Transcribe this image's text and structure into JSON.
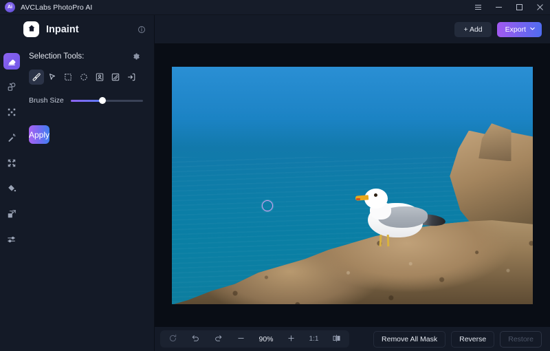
{
  "titlebar": {
    "logo_text": "Ai",
    "app_title": "AVCLabs PhotoPro AI",
    "menu_icon": "hamburger-menu-icon",
    "minimize_icon": "minimize-icon",
    "maximize_icon": "maximize-icon",
    "close_icon": "close-icon"
  },
  "panel": {
    "home_icon": "home-icon",
    "page_title": "Inpaint",
    "info_icon": "info-icon",
    "section_title": "Selection Tools:",
    "gear_icon": "gear-icon",
    "tools": [
      {
        "name": "brush-tool",
        "icon": "brush-icon",
        "active": true
      },
      {
        "name": "lasso-tool",
        "icon": "cursor-icon",
        "active": false
      },
      {
        "name": "rectangle-tool",
        "icon": "rectangle-icon",
        "active": false
      },
      {
        "name": "ellipse-tool",
        "icon": "ellipse-icon",
        "active": false
      },
      {
        "name": "portrait-tool",
        "icon": "portrait-icon",
        "active": false
      },
      {
        "name": "pattern-tool",
        "icon": "hatched-box-icon",
        "active": false
      },
      {
        "name": "import-tool",
        "icon": "arrow-into-box-icon",
        "active": false
      }
    ],
    "brush_size_label": "Brush Size",
    "brush_size_percent": 44,
    "apply_label": "Apply"
  },
  "rail": {
    "items": [
      {
        "name": "rail-item-inpaint",
        "icon": "eraser-icon",
        "active": true
      },
      {
        "name": "rail-item-replace",
        "icon": "object-swap-icon",
        "active": false
      },
      {
        "name": "rail-item-enhance",
        "icon": "sparkle-grid-icon",
        "active": false
      },
      {
        "name": "rail-item-magic",
        "icon": "magic-wand-icon",
        "active": false
      },
      {
        "name": "rail-item-upscale",
        "icon": "expand-corners-icon",
        "active": false
      },
      {
        "name": "rail-item-colorize",
        "icon": "paint-bucket-icon",
        "active": false
      },
      {
        "name": "rail-item-resize",
        "icon": "resize-icon",
        "active": false
      },
      {
        "name": "rail-item-adjust",
        "icon": "sliders-icon",
        "active": false
      }
    ]
  },
  "toolbar": {
    "add_label": "+ Add",
    "export_label": "Export",
    "export_chevron_icon": "chevron-down-icon"
  },
  "canvas": {
    "image_description": "Seagull standing on a rocky outcrop beside blue sea water",
    "brush_cursor_icon": "brush-cursor-circle"
  },
  "bottombar": {
    "reset_icon": "reset-icon",
    "undo_icon": "undo-icon",
    "redo_icon": "redo-icon",
    "zoom_out_icon": "minus-icon",
    "zoom_level": "90%",
    "zoom_in_icon": "plus-icon",
    "fit_label": "1:1",
    "compare_icon": "split-view-icon",
    "remove_all_mask_label": "Remove All Mask",
    "reverse_label": "Reverse",
    "restore_label": "Restore"
  },
  "colors": {
    "accent_purple": "#8c63f0",
    "accent_blue": "#4f6cf0",
    "panel_bg": "#141a27",
    "canvas_bg": "#090d15",
    "brush_cursor": "#d79ff5"
  }
}
